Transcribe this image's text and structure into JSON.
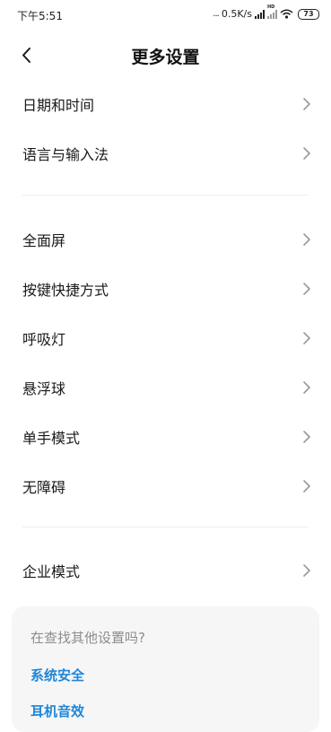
{
  "status": {
    "time": "下午5:51",
    "dots": "...",
    "speed": "0.5K/s",
    "hd": "HD",
    "battery": "73"
  },
  "header": {
    "title": "更多设置",
    "back_icon": "chevron-left-icon"
  },
  "groups": [
    {
      "items": [
        {
          "label": "日期和时间"
        },
        {
          "label": "语言与输入法"
        }
      ]
    },
    {
      "items": [
        {
          "label": "全面屏"
        },
        {
          "label": "按键快捷方式"
        },
        {
          "label": "呼吸灯"
        },
        {
          "label": "悬浮球"
        },
        {
          "label": "单手模式"
        },
        {
          "label": "无障碍"
        }
      ]
    },
    {
      "items": [
        {
          "label": "企业模式"
        }
      ]
    }
  ],
  "suggest": {
    "question": "在查找其他设置吗?",
    "links": [
      {
        "label": "系统安全"
      },
      {
        "label": "耳机音效"
      }
    ]
  },
  "colors": {
    "accent": "#1f86d8",
    "chevron": "#9a9a9a",
    "divider": "#ececec"
  }
}
